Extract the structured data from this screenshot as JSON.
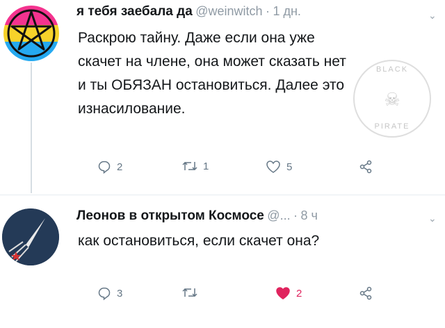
{
  "tweet1": {
    "name": "я тебя заебала да",
    "handle": "@weinwitch",
    "time": "1 дн.",
    "text": [
      "Раскрою тайну. Даже если она уже",
      "скачет на члене, она может сказать нет",
      "и ты ОБЯЗАН остановиться. Далее это",
      "изнасилование."
    ],
    "actions": {
      "reply": "2",
      "retweet": "1",
      "like": "5"
    }
  },
  "tweet2": {
    "name": "Леонов в открытом Космосе",
    "handle": "@...",
    "time": "8 ч",
    "text": "как остановиться, если скачет она?",
    "actions": {
      "reply": "3",
      "retweet": "",
      "like": "2"
    },
    "liked": true
  },
  "watermark": {
    "line1": "BLACK",
    "line2": "PIRATE"
  },
  "colors": {
    "like_active": "#e0245e",
    "icon": "#657786",
    "thread": "#d6dde3"
  },
  "icons": [
    "pentagram-avatar",
    "rocket-avatar",
    "reply-icon",
    "retweet-icon",
    "heart-icon",
    "share-icon",
    "chevron-down-icon"
  ]
}
